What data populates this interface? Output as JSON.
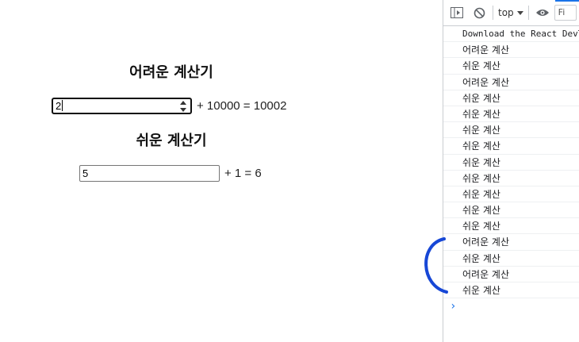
{
  "hard_calculator": {
    "heading": "어려운 계산기",
    "input_value": "2",
    "expression": "+ 10000 = 10002"
  },
  "easy_calculator": {
    "heading": "쉬운 계산기",
    "input_value": "5",
    "expression": "+ 1 = 6"
  },
  "devtools": {
    "context_label": "top",
    "filter_placeholder": "Fi",
    "icons": [
      "sidebar-toggle-icon",
      "clear-console-icon",
      "eye-icon"
    ],
    "accent_color": "#1a73e8",
    "logs": [
      "Download the React DevTools",
      "어려운 계산",
      "쉬운 계산",
      "어려운 계산",
      "쉬운 계산",
      "쉬운 계산",
      "쉬운 계산",
      "쉬운 계산",
      "쉬운 계산",
      "쉬운 계산",
      "쉬운 계산",
      "쉬운 계산",
      "쉬운 계산",
      "어려운 계산",
      "쉬운 계산",
      "어려운 계산",
      "쉬운 계산"
    ],
    "prompt_symbol": "›"
  },
  "annotation": {
    "color": "#1747d6"
  }
}
